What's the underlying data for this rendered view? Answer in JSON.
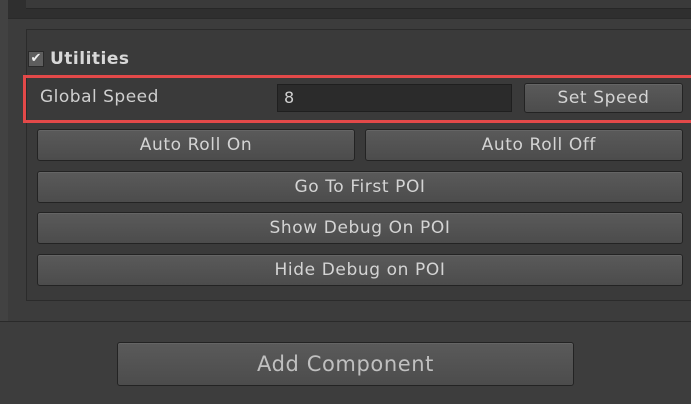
{
  "utilities": {
    "checked": true,
    "check_glyph": "✔",
    "title": "Utilities"
  },
  "global_speed": {
    "label": "Global Speed",
    "value": "8",
    "button_label": "Set Speed"
  },
  "buttons": {
    "auto_roll_on": "Auto Roll On",
    "auto_roll_off": "Auto Roll Off",
    "go_to_first_poi": "Go To First POI",
    "show_debug_on_poi": "Show Debug On POI",
    "hide_debug_on_poi": "Hide Debug on POI"
  },
  "footer": {
    "add_component": "Add Component"
  },
  "colors": {
    "highlight": "#e34949",
    "background": "#383838",
    "button": "#525252"
  }
}
